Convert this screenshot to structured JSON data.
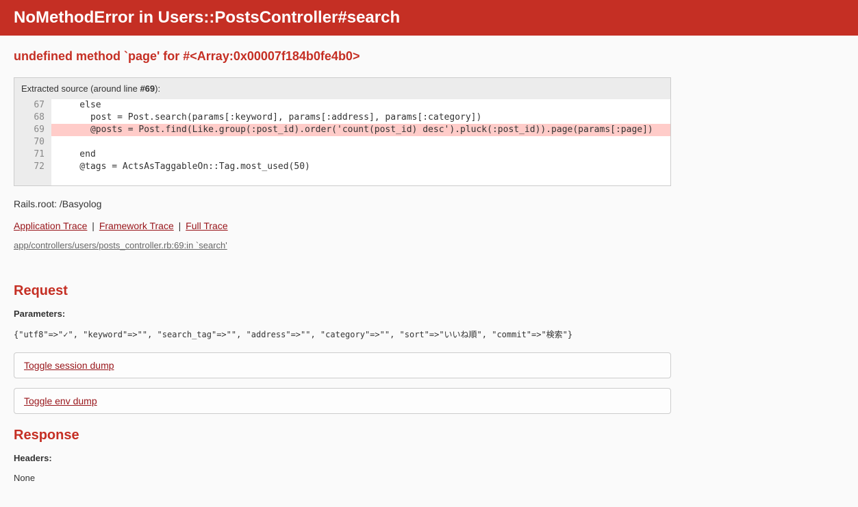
{
  "header": {
    "title": "NoMethodError in Users::PostsController#search"
  },
  "error": {
    "message": "undefined method `page' for #<Array:0x00007f184b0fe4b0>"
  },
  "source": {
    "intro": "Extracted source (around line ",
    "line_label": "#69",
    "intro_close": "):",
    "lines": [
      {
        "num": "67",
        "code": "    else",
        "hl": false
      },
      {
        "num": "68",
        "code": "      post = Post.search(params[:keyword], params[:address], params[:category])",
        "hl": false
      },
      {
        "num": "69",
        "code": "      @posts = Post.find(Like.group(:post_id).order('count(post_id) desc').pluck(:post_id)).page(params[:page])",
        "hl": true
      },
      {
        "num": "70",
        "code": "",
        "hl": false
      },
      {
        "num": "71",
        "code": "    end",
        "hl": false
      },
      {
        "num": "72",
        "code": "    @tags = ActsAsTaggableOn::Tag.most_used(50)",
        "hl": false
      }
    ]
  },
  "rails_root": "Rails.root: /Basyolog",
  "traces": {
    "app": "Application Trace",
    "framework": "Framework Trace",
    "full": "Full Trace",
    "line": "app/controllers/users/posts_controller.rb:69:in `search'"
  },
  "request": {
    "heading": "Request",
    "params_label": "Parameters",
    "params_colon": ":",
    "params_dump": "{\"utf8\"=>\"✓\", \"keyword\"=>\"\", \"search_tag\"=>\"\", \"address\"=>\"\", \"category\"=>\"\", \"sort\"=>\"いいね順\", \"commit\"=>\"検索\"}",
    "toggle_session": "Toggle session dump",
    "toggle_env": "Toggle env dump"
  },
  "response": {
    "heading": "Response",
    "headers_label": "Headers",
    "headers_colon": ":",
    "headers_value": "None"
  }
}
